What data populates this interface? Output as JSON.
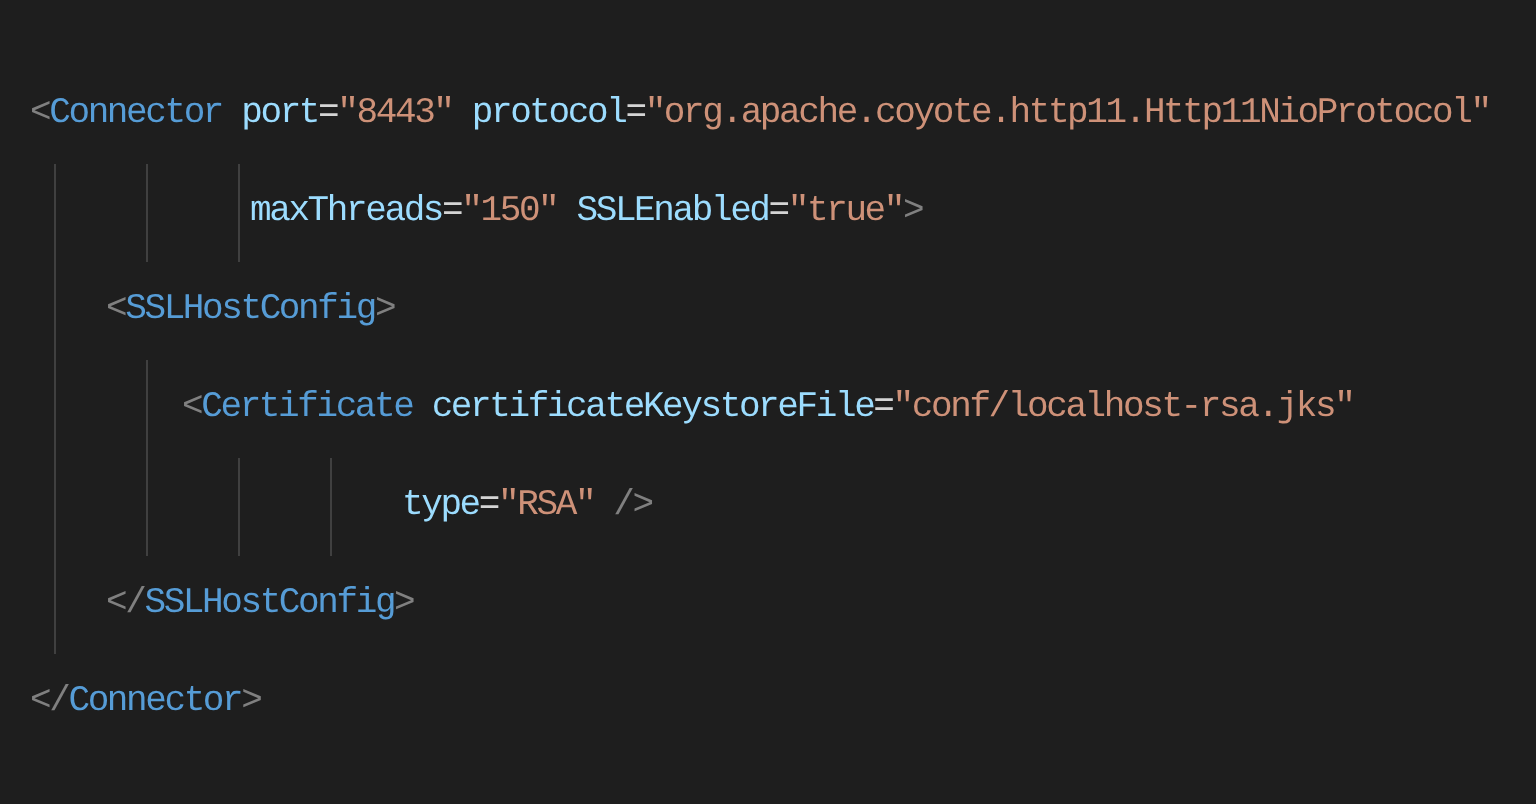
{
  "elements": [
    {
      "lines": [
        [
          {
            "kind": "bracket",
            "text": "<"
          },
          {
            "kind": "tag",
            "text": "Connector"
          },
          {
            "kind": "attr",
            "text": "port"
          },
          {
            "kind": "punct",
            "text": "="
          },
          {
            "kind": "string",
            "text": "\"8443\""
          },
          {
            "kind": "attr",
            "text": "protocol"
          },
          {
            "kind": "punct",
            "text": "="
          },
          {
            "kind": "string",
            "text": "\"org.apache.coyote.http11.Http11NioProtocol\""
          }
        ],
        [
          {
            "kind": "attrfirst",
            "text": "maxThreads"
          },
          {
            "kind": "punct",
            "text": "="
          },
          {
            "kind": "string",
            "text": "\"150\""
          },
          {
            "kind": "attr",
            "text": "SSLEnabled"
          },
          {
            "kind": "punct",
            "text": "="
          },
          {
            "kind": "string",
            "text": "\"true\""
          },
          {
            "kind": "bracket",
            "text": ">"
          }
        ]
      ],
      "closing": [
        {
          "kind": "bracket",
          "text": "</"
        },
        {
          "kind": "tag",
          "text": "Connector"
        },
        {
          "kind": "bracket",
          "text": ">"
        }
      ],
      "children": [
        {
          "lines": [
            [
              {
                "kind": "bracket",
                "text": "<"
              },
              {
                "kind": "tag",
                "text": "SSLHostConfig"
              },
              {
                "kind": "bracket",
                "text": ">"
              }
            ]
          ],
          "closing": [
            {
              "kind": "bracket",
              "text": "</"
            },
            {
              "kind": "tag",
              "text": "SSLHostConfig"
            },
            {
              "kind": "bracket",
              "text": ">"
            }
          ],
          "children": [
            {
              "lines": [
                [
                  {
                    "kind": "bracket",
                    "text": "<"
                  },
                  {
                    "kind": "tag",
                    "text": "Certificate"
                  },
                  {
                    "kind": "attr",
                    "text": "certificateKeystoreFile"
                  },
                  {
                    "kind": "punct",
                    "text": "="
                  },
                  {
                    "kind": "string",
                    "text": "\"conf/localhost-rsa.jks\""
                  }
                ],
                [
                  {
                    "kind": "attrfirst",
                    "text": "type"
                  },
                  {
                    "kind": "punct",
                    "text": "="
                  },
                  {
                    "kind": "string",
                    "text": "\"RSA\""
                  },
                  {
                    "kind": "selfclose",
                    "text": "/>"
                  }
                ]
              ]
            }
          ]
        }
      ]
    }
  ]
}
